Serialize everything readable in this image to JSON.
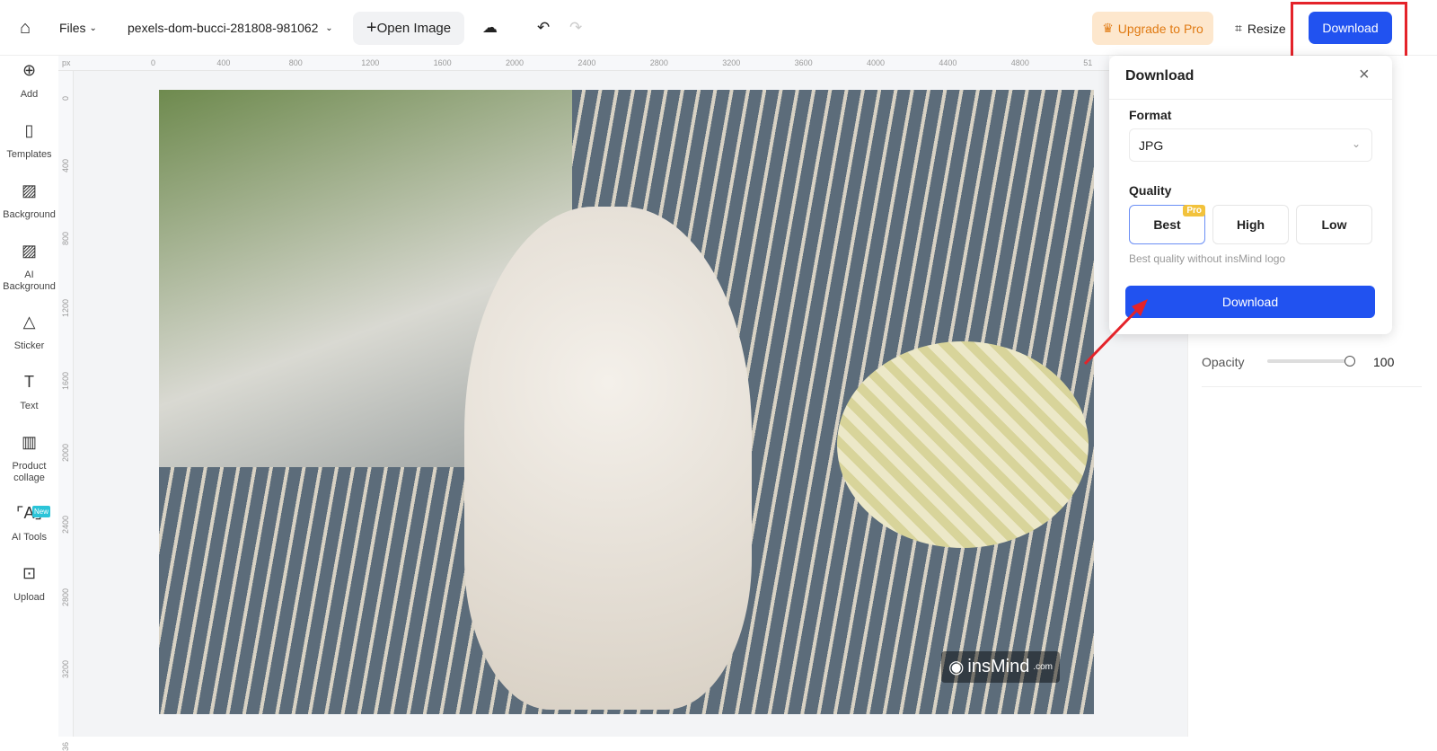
{
  "topbar": {
    "files": "Files",
    "filename": "pexels-dom-bucci-281808-981062",
    "open_image": "Open Image",
    "upgrade": "Upgrade to Pro",
    "resize": "Resize",
    "download": "Download"
  },
  "sidebar": {
    "items": [
      {
        "label": "Add",
        "icon": "plus-circle-icon"
      },
      {
        "label": "Templates",
        "icon": "templates-icon"
      },
      {
        "label": "Background",
        "icon": "background-icon"
      },
      {
        "label": "AI Background",
        "icon": "ai-background-icon"
      },
      {
        "label": "Sticker",
        "icon": "sticker-icon"
      },
      {
        "label": "Text",
        "icon": "text-icon"
      },
      {
        "label": "Product collage",
        "icon": "collage-icon"
      },
      {
        "label": "AI Tools",
        "icon": "ai-tools-icon",
        "badge": "New"
      },
      {
        "label": "Upload",
        "icon": "upload-icon"
      }
    ]
  },
  "ruler": {
    "unit": "px",
    "h": [
      "0",
      "400",
      "800",
      "1200",
      "1600",
      "2000",
      "2400",
      "2800",
      "3200",
      "3600",
      "4000",
      "4400",
      "4800",
      "51"
    ],
    "v": [
      "0",
      "400",
      "800",
      "1200",
      "1600",
      "2000",
      "2400",
      "2800",
      "3200",
      "36"
    ]
  },
  "canvas": {
    "watermark": "insMind",
    "watermark_suffix": ".com"
  },
  "download_panel": {
    "title": "Download",
    "format_label": "Format",
    "format_value": "JPG",
    "quality_label": "Quality",
    "qualities": [
      "Best",
      "High",
      "Low"
    ],
    "selected": "Best",
    "pro_badge": "Pro",
    "hint": "Best quality without insMind logo",
    "button": "Download"
  },
  "right_panel": {
    "opacity_label": "Opacity",
    "opacity_value": "100"
  },
  "colors": {
    "accent": "#2152f0",
    "highlight": "#e4232a",
    "upgrade": "#e07a12"
  }
}
